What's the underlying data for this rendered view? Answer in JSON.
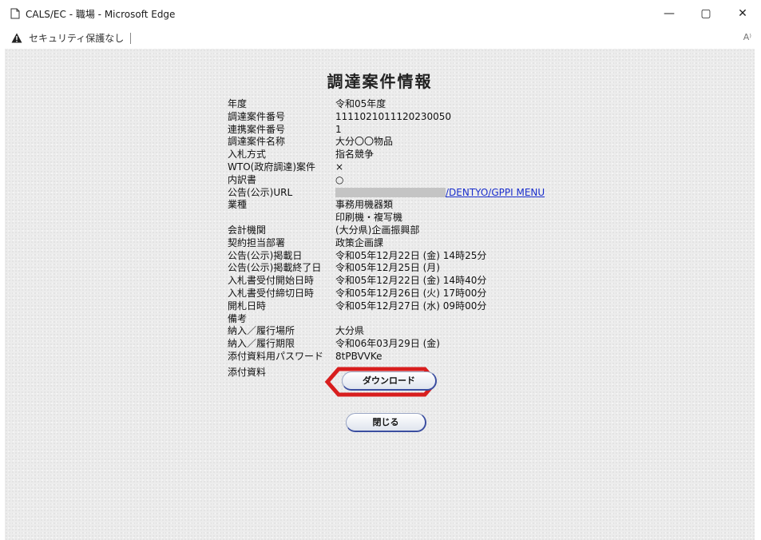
{
  "window": {
    "title": "CALS/EC - 職場 - Microsoft Edge",
    "minimize": "—",
    "maximize": "▢",
    "close": "✕"
  },
  "address": {
    "security_text": "セキュリティ保護なし",
    "reader_label": "A⁾"
  },
  "page": {
    "title": "調達案件情報",
    "rows": [
      {
        "label": "年度",
        "value": "令和05年度"
      },
      {
        "label": "調達案件番号",
        "value": "1111021011120230050"
      },
      {
        "label": "連携案件番号",
        "value": "1"
      },
      {
        "label": "調達案件名称",
        "value": "大分〇〇物品"
      },
      {
        "label": "入札方式",
        "value": "指名競争"
      },
      {
        "label": "WTO(政府調達)案件",
        "value": "×"
      },
      {
        "label": "内訳書",
        "value": "○"
      },
      {
        "label": "公告(公示)URL",
        "value": "/DENTYO/GPPI MENU"
      },
      {
        "label": "業種",
        "value": "事務用機器類"
      },
      {
        "label": "",
        "value": "印刷機・複写機"
      },
      {
        "label": "会計機関",
        "value": "(大分県)企画振興部"
      },
      {
        "label": "契約担当部署",
        "value": "政策企画課"
      },
      {
        "label": "公告(公示)掲載日",
        "value": "令和05年12月22日 (金) 14時25分"
      },
      {
        "label": "公告(公示)掲載終了日",
        "value": "令和05年12月25日 (月)"
      },
      {
        "label": "入札書受付開始日時",
        "value": "令和05年12月22日 (金) 14時40分"
      },
      {
        "label": "入札書受付締切日時",
        "value": "令和05年12月26日 (火) 17時00分"
      },
      {
        "label": "開札日時",
        "value": "令和05年12月27日 (水) 09時00分"
      },
      {
        "label": "備考",
        "value": ""
      },
      {
        "label": "納入／履行場所",
        "value": "大分県"
      },
      {
        "label": "納入／履行期限",
        "value": "令和06年03月29日 (金)"
      },
      {
        "label": "添付資料用パスワード",
        "value": "8tPBVVKe"
      }
    ],
    "attachment_label": "添付資料",
    "download_button": "ダウンロード",
    "close_button": "閉じる",
    "highlight_color": "#d81e1e"
  }
}
